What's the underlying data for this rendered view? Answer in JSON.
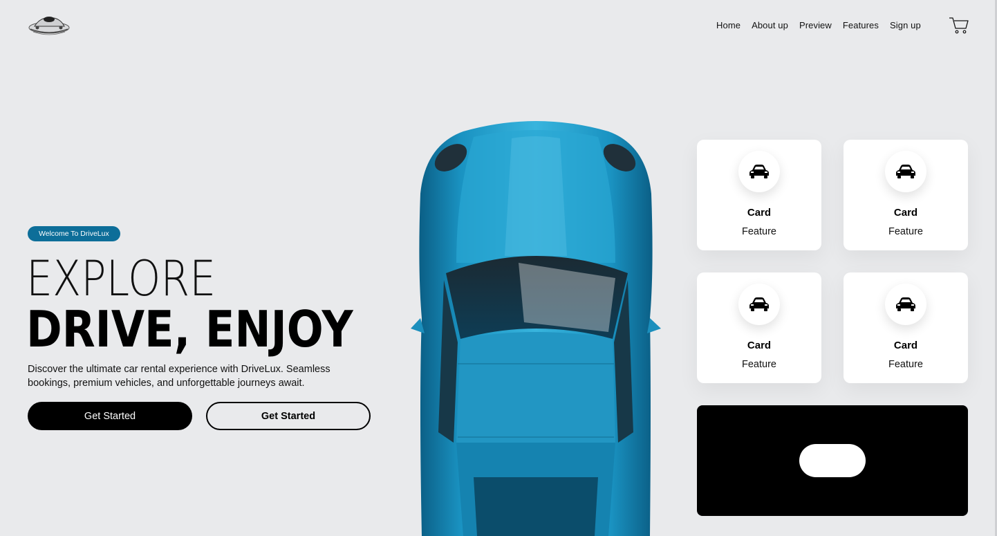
{
  "nav": {
    "items": [
      "Home",
      "About up",
      "Preview",
      "Features",
      "Sign up"
    ]
  },
  "icons": {
    "logo": "car-logo-icon",
    "cart": "shopping-cart-icon",
    "card": "car-icon"
  },
  "hero": {
    "badge": "Welcome To DriveLux",
    "headline_line1": "EXPLORE",
    "headline_line2": "DRIVE, ENJOY",
    "description": "Discover the ultimate car rental experience with DriveLux. Seamless bookings, premium vehicles, and unforgettable journeys await.",
    "primary_button": "Get Started",
    "secondary_button": "Get Started"
  },
  "cards": [
    {
      "title": "Card",
      "subtitle": "Feature"
    },
    {
      "title": "Card",
      "subtitle": "Feature"
    },
    {
      "title": "Card",
      "subtitle": "Feature"
    },
    {
      "title": "Card",
      "subtitle": "Feature"
    }
  ],
  "colors": {
    "background": "#e9eaec",
    "badge": "#0d6e99",
    "car_body": "#1d9cc6",
    "promo": "#000000"
  }
}
